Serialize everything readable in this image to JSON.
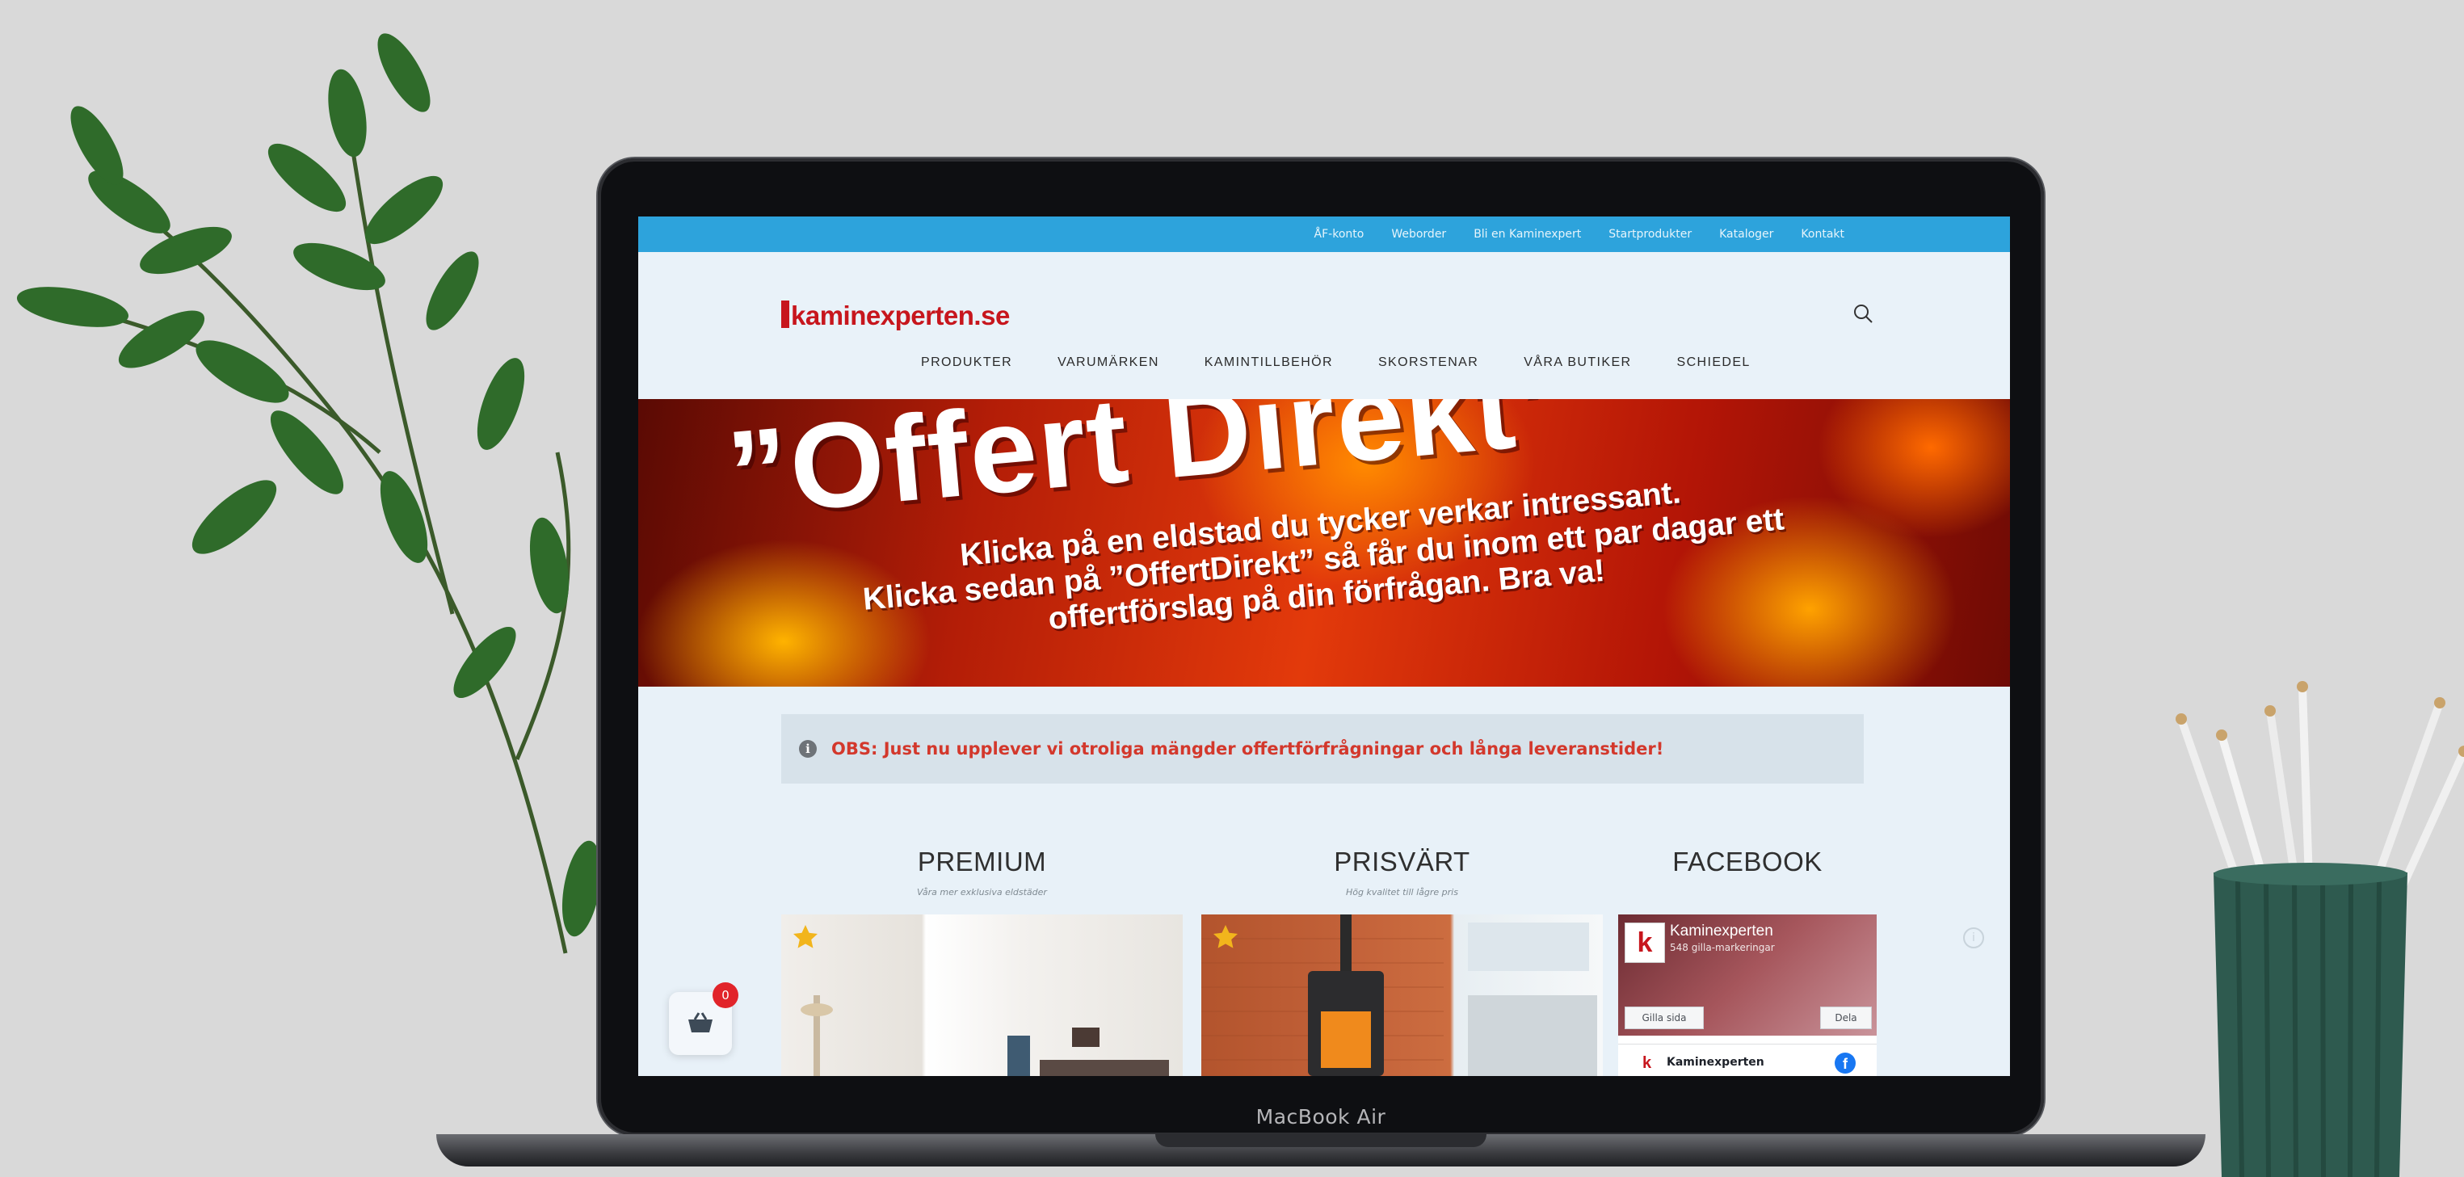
{
  "device": {
    "label": "MacBook Air"
  },
  "topbar": {
    "links": [
      "ÅF-konto",
      "Weborder",
      "Bli en Kaminexpert",
      "Startprodukter",
      "Kataloger",
      "Kontakt"
    ]
  },
  "header": {
    "logo": "kaminexperten.se",
    "nav": [
      "PRODUKTER",
      "VARUMÄRKEN",
      "KAMINTILLBEHÖR",
      "SKORSTENAR",
      "VÅRA BUTIKER",
      "SCHIEDEL"
    ]
  },
  "hero": {
    "title": "”Offert Direkt”",
    "line1": "Klicka på en eldstad du tycker verkar intressant.",
    "line2": "Klicka sedan på ”OffertDirekt” så får du inom ett par dagar ett",
    "line3": "offertförslag på din förfrågan. Bra va!"
  },
  "notice": {
    "text": "OBS: Just nu upplever vi otroliga mängder offertförfrågningar och långa leveranstider!"
  },
  "columns": {
    "premium": {
      "title": "PREMIUM",
      "subtitle": "Våra mer exklusiva eldstäder"
    },
    "prisvart": {
      "title": "PRISVÄRT",
      "subtitle": "Hög kvalitet till lågre pris"
    },
    "facebook": {
      "title": "FACEBOOK"
    }
  },
  "facebook_widget": {
    "page_name": "Kaminexperten",
    "likes": "548 gilla-markeringar",
    "like_button": "Gilla sida",
    "share_button": "Dela",
    "post_author": "Kaminexperten"
  },
  "cart": {
    "count": "0"
  },
  "colors": {
    "topbar": "#2da3dc",
    "brand_red": "#c7161d",
    "notice_text": "#d3382c",
    "facebook_blue": "#1877f2"
  }
}
